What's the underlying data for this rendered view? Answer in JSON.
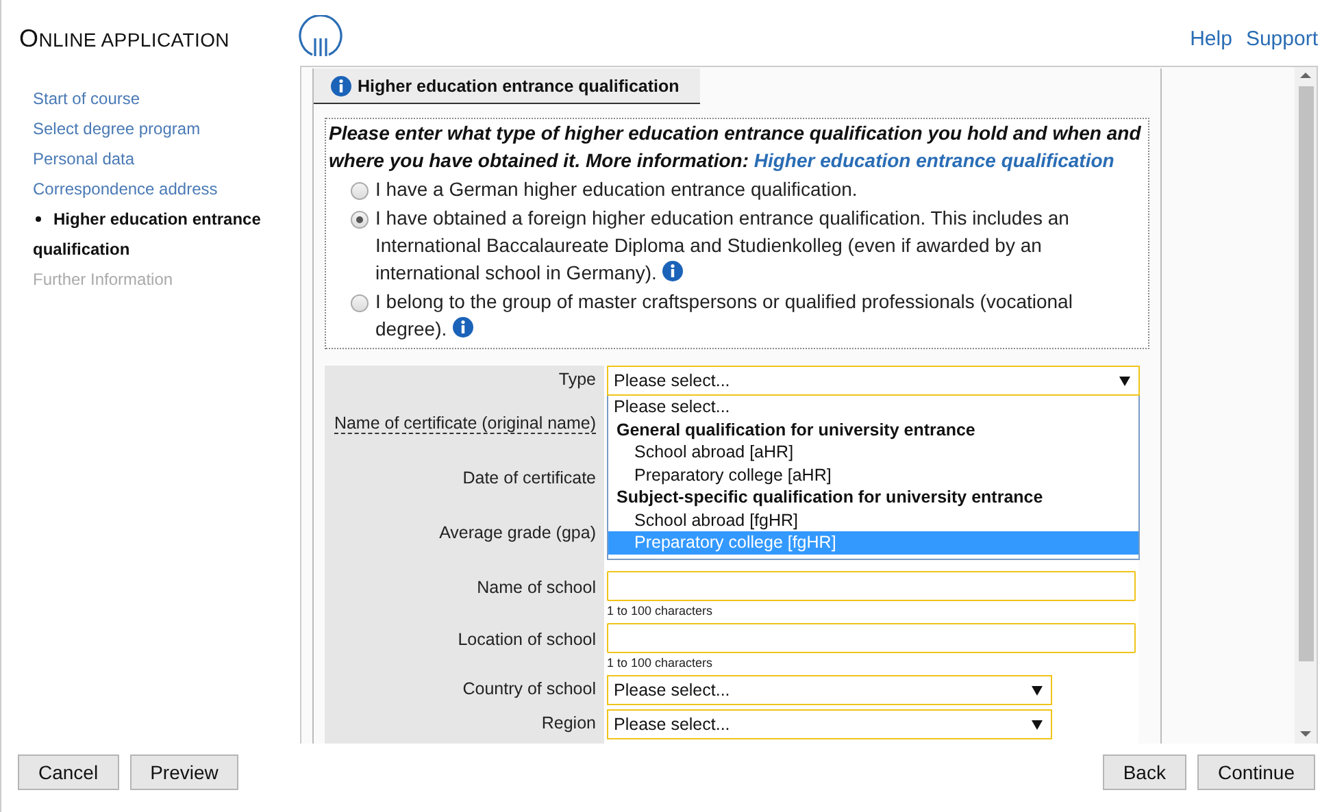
{
  "header": {
    "title": "ONLINE APPLICATION",
    "links": [
      "Help",
      "Support"
    ]
  },
  "sidebar": {
    "items": [
      {
        "label": "Start of course",
        "selected": false,
        "disabled": false
      },
      {
        "label": "Select degree program",
        "selected": false,
        "disabled": false
      },
      {
        "label": "Personal data",
        "selected": false,
        "disabled": false
      },
      {
        "label": "Correspondence address",
        "selected": false,
        "disabled": false
      },
      {
        "label": "Higher education entrance qualification",
        "selected": true,
        "disabled": false
      },
      {
        "label": "Further Information",
        "selected": false,
        "disabled": true
      }
    ]
  },
  "tab": {
    "label": "Higher education entrance qualification"
  },
  "intro": {
    "text": "Please enter what type of higher education entrance qualification you hold and when and where you have obtained it. More information:",
    "link": "Higher education entrance qualification"
  },
  "options": [
    {
      "label": "I have a German higher education entrance qualification.",
      "selected": false,
      "info": false
    },
    {
      "label": "I have obtained a foreign higher education entrance qualification. This includes an International Baccalaureate Diploma and Studienkolleg (even if awarded by an international school in Germany).",
      "selected": true,
      "info": true
    },
    {
      "label": "I belong to the group of master craftspersons or qualified professionals (vocational degree).",
      "selected": false,
      "info": true
    }
  ],
  "form": [
    {
      "label": "Type",
      "kind": "select",
      "value": "Please select...",
      "tooltip": false,
      "wide": true,
      "open": true
    },
    {
      "label": "Name of certificate (original name)",
      "kind": "covered",
      "tooltip": true
    },
    {
      "label": "Date of certificate",
      "kind": "covered",
      "tooltip": false
    },
    {
      "label": "Average grade (gpa)",
      "kind": "covered",
      "tooltip": false
    },
    {
      "label": "Name of school",
      "kind": "text",
      "hint": "1 to 100 characters",
      "tooltip": false
    },
    {
      "label": "Location of school",
      "kind": "text",
      "hint": "1 to 100 characters",
      "tooltip": false
    },
    {
      "label": "Country of school",
      "kind": "select",
      "value": "Please select...",
      "tooltip": false
    },
    {
      "label": "Region",
      "kind": "select",
      "value": "Please select...",
      "tooltip": false
    }
  ],
  "dropdown": [
    {
      "label": "Please select...",
      "kind": "option",
      "selected": false
    },
    {
      "label": "General qualification for university entrance",
      "kind": "group",
      "selected": false
    },
    {
      "label": "School abroad [aHR]",
      "kind": "option",
      "selected": false
    },
    {
      "label": "Preparatory college [aHR]",
      "kind": "option",
      "selected": false
    },
    {
      "label": "Subject-specific qualification for university entrance",
      "kind": "group",
      "selected": false
    },
    {
      "label": "School abroad [fgHR]",
      "kind": "option",
      "selected": false
    },
    {
      "label": "Preparatory college [fgHR]",
      "kind": "option",
      "selected": true
    }
  ],
  "buttons_left": [
    "Cancel",
    "Preview"
  ],
  "buttons_right": [
    "Back",
    "Continue"
  ]
}
